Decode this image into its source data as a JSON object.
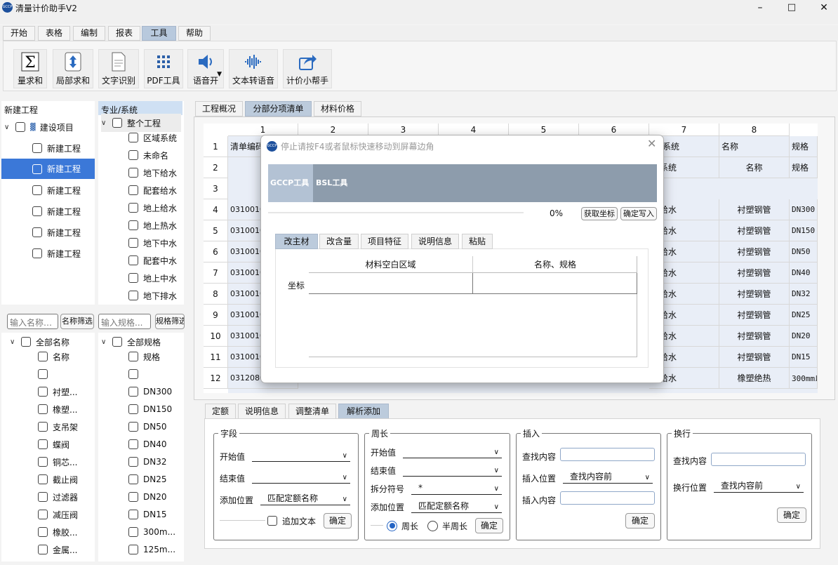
{
  "app": {
    "title": "清量计价助手V2",
    "logo_text": "GCCP"
  },
  "menu": [
    "开始",
    "表格",
    "编制",
    "报表",
    "工具",
    "帮助"
  ],
  "ribbon": [
    {
      "label": "量求和",
      "icon": "sigma-icon"
    },
    {
      "label": "局部求和",
      "icon": "partial-sum-icon"
    },
    {
      "label": "文字识别",
      "icon": "document-ocr-icon"
    },
    {
      "label": "PDF工具",
      "icon": "pdf-grid-icon"
    },
    {
      "label": "语音开",
      "icon": "speaker-icon"
    },
    {
      "label": "文本转语音",
      "icon": "waveform-icon"
    },
    {
      "label": "计价小帮手",
      "icon": "share-arrow-icon"
    }
  ],
  "project_tree": {
    "header": "新建工程",
    "root": "建设项目",
    "items": [
      "新建工程",
      "新建工程",
      "新建工程",
      "新建工程",
      "新建工程",
      "新建工程"
    ]
  },
  "system_tree": {
    "header": "专业/系统",
    "root": "整个工程",
    "items": [
      "区域系统",
      "未命名",
      "地下给水",
      "配套给水",
      "地上给水",
      "地上热水",
      "地下中水",
      "配套中水",
      "地上中水",
      "地下排水"
    ]
  },
  "name_filter": {
    "placeholder": "输入名称…",
    "button": "名称筛选",
    "root": "全部名称",
    "items": [
      "名称",
      "",
      "衬塑...",
      "橡塑...",
      "支吊架",
      "蝶阀",
      "铜芯...",
      "截止阀",
      "过滤器",
      "减压阀",
      "橡胶...",
      "金属..."
    ]
  },
  "spec_filter": {
    "placeholder": "输入规格...",
    "button": "规格筛选",
    "root": "全部规格",
    "items": [
      "规格",
      "",
      "DN300",
      "DN150",
      "DN50",
      "DN40",
      "DN32",
      "DN25",
      "DN20",
      "DN15",
      "300m...",
      "125m..."
    ]
  },
  "content_tabs": [
    "工程概况",
    "分部分项清单",
    "材料价格"
  ],
  "grid": {
    "col_numbers": [
      "1",
      "2",
      "3",
      "4",
      "5",
      "6",
      "7",
      "8"
    ],
    "row_numbers": [
      "1",
      "2",
      "3",
      "4",
      "5",
      "6",
      "7",
      "8",
      "9",
      "10",
      "11",
      "12"
    ],
    "header_row": [
      "清单编码",
      "",
      "",
      "",
      "",
      "",
      "业/系统",
      "名称",
      "规格"
    ],
    "row2": [
      "",
      "",
      "",
      "",
      "",
      "",
      "域系统",
      "名称",
      "规格"
    ],
    "rows": [
      [
        "0310010",
        "下给水",
        "衬塑钢管",
        "DN300"
      ],
      [
        "0310010",
        "下给水",
        "衬塑钢管",
        "DN150"
      ],
      [
        "0310010",
        "下给水",
        "衬塑钢管",
        "DN50"
      ],
      [
        "0310010",
        "下给水",
        "衬塑钢管",
        "DN40"
      ],
      [
        "0310010",
        "下给水",
        "衬塑钢管",
        "DN32"
      ],
      [
        "0310010",
        "下给水",
        "衬塑钢管",
        "DN25"
      ],
      [
        "0310010",
        "下给水",
        "衬塑钢管",
        "DN20"
      ],
      [
        "0310010",
        "下给水",
        "衬塑钢管",
        "DN15"
      ],
      [
        "0312080",
        "下给水",
        "橡塑绝热",
        "300mm以"
      ]
    ]
  },
  "bottom_tabs": [
    "定额",
    "说明信息",
    "调整清单",
    "解析添加"
  ],
  "field_group": {
    "title": "字段",
    "start_label": "开始值",
    "end_label": "结束值",
    "add_pos_label": "添加位置",
    "add_pos_value": "匹配定额名称",
    "append_text": "追加文本",
    "confirm": "确定"
  },
  "perimeter_group": {
    "title": "周长",
    "start_label": "开始值",
    "end_label": "结束值",
    "split_label": "拆分符号",
    "split_value": "*",
    "add_pos_label": "添加位置",
    "add_pos_value": "匹配定额名称",
    "radio_full": "周长",
    "radio_half": "半周长",
    "confirm": "确定"
  },
  "insert_group": {
    "title": "插入",
    "find_label": "查找内容",
    "pos_label": "插入位置",
    "pos_value": "查找内容前",
    "content_label": "插入内容",
    "confirm": "确定"
  },
  "wrap_group": {
    "title": "换行",
    "find_label": "查找内容",
    "pos_label": "换行位置",
    "pos_value": "查找内容前",
    "confirm": "确定"
  },
  "dialog": {
    "title": "停止请按F4或者鼠标快速移动到屏幕边角",
    "tool_gccp": "GCCP工具",
    "tool_bsl": "BSL工具",
    "progress_text": "0%",
    "progress_value": 0,
    "btn_get_coord": "获取坐标",
    "btn_confirm_write": "确定写入",
    "tabs": [
      "改主材",
      "改含量",
      "项目特征",
      "说明信息",
      "粘贴"
    ],
    "col_material": "材料空白区域",
    "col_name_spec": "名称、规格",
    "row_label": "坐标"
  },
  "colors": {
    "accent": "#3b78d8",
    "active_tab": "#b8c9dd",
    "grid_header": "#e6ecf5",
    "dialog_band": "#8d9cac"
  }
}
